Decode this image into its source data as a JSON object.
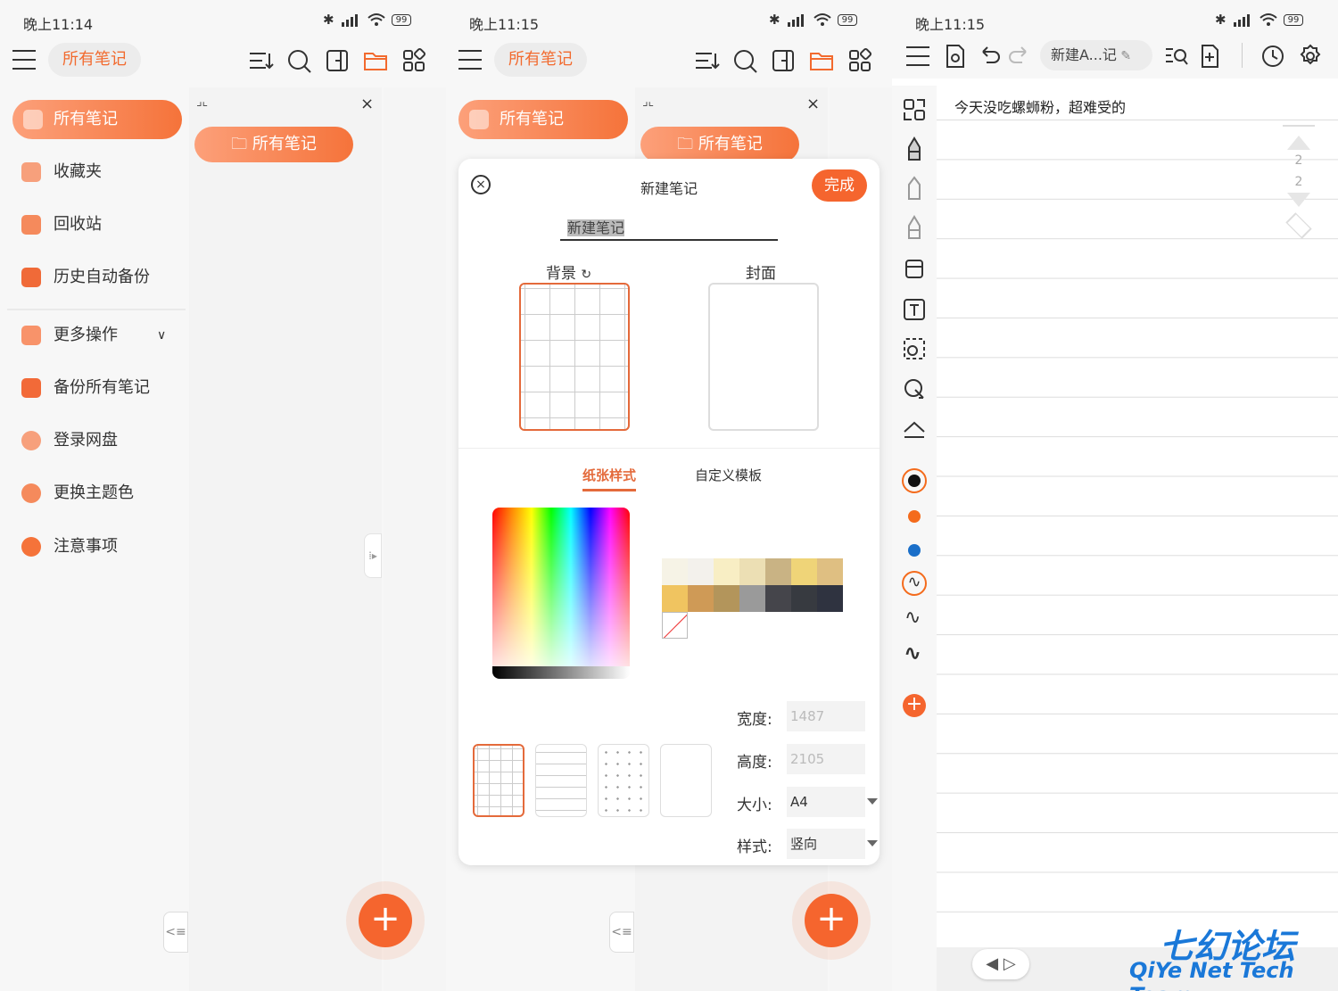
{
  "status": {
    "time_p1": "晚上11:14",
    "time_p2": "晚上11:15",
    "time_p3": "晚上11:15",
    "battery": "99"
  },
  "header": {
    "chip": "所有笔记"
  },
  "sidebar": {
    "items": [
      {
        "label": "所有笔记",
        "icon": "notes-list-icon"
      },
      {
        "label": "收藏夹",
        "icon": "star-icon"
      },
      {
        "label": "回收站",
        "icon": "trash-icon"
      },
      {
        "label": "历史自动备份",
        "icon": "history-backup-icon"
      },
      {
        "label": "更多操作",
        "icon": "grid-more-icon"
      },
      {
        "label": "备份所有笔记",
        "icon": "backup-icon"
      },
      {
        "label": "登录网盘",
        "icon": "cloud-upload-icon"
      },
      {
        "label": "更换主题色",
        "icon": "palette-icon"
      },
      {
        "label": "注意事项",
        "icon": "warning-icon"
      }
    ]
  },
  "folder": {
    "chip": "所有笔记"
  },
  "dialog": {
    "title": "新建笔记",
    "done": "完成",
    "name_value": "新建笔记",
    "background_label": "背景",
    "cover_label": "封面",
    "tabs": [
      "纸张样式",
      "自定义模板"
    ],
    "width_label": "宽度:",
    "width_value": "1487",
    "height_label": "高度:",
    "height_value": "2105",
    "size_label": "大小:",
    "size_value": "A4",
    "style_label": "样式:",
    "style_value": "竖向"
  },
  "swatch_colors": [
    [
      "#f6f3e6",
      "#f3f1ec",
      "#f8eec4",
      "#ecdfb4",
      "#c9b384",
      "#efd478",
      "#dfbf82"
    ],
    [
      "#f0c460",
      "#cf9a56",
      "#b3955b",
      "#9a9a9a",
      "#45454b",
      "#373a40",
      "#2f3340"
    ]
  ],
  "editor": {
    "title_chip": "新建A...记",
    "note_text": "今天没吃螺蛳粉，超难受的",
    "page_current": "2",
    "page_total": "2",
    "pen_colors": [
      "#111111",
      "#f46b1c",
      "#1a6fc9"
    ]
  },
  "watermark": {
    "line1": "七幻论坛",
    "line2": "QiYe Net Tech Team"
  },
  "colors": {
    "accent": "#f5652e"
  }
}
